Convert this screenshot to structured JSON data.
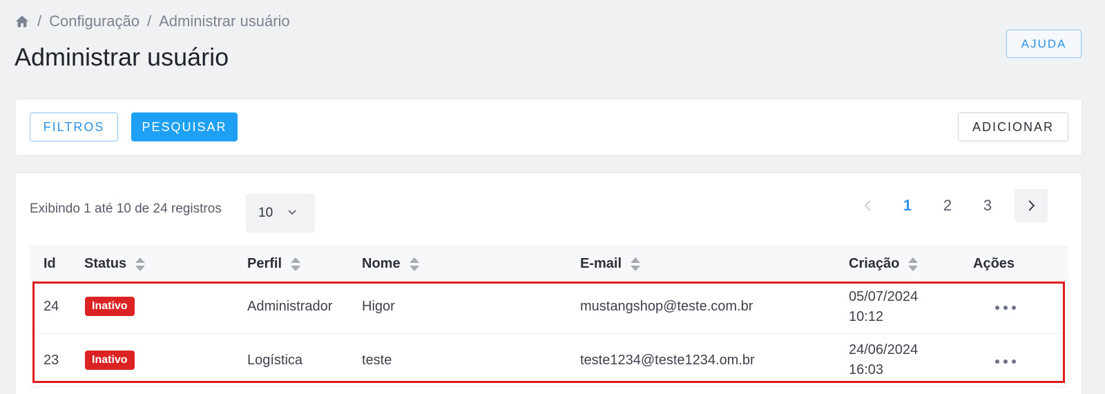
{
  "breadcrumb": {
    "home_icon": "home-icon",
    "separator": "/",
    "items": [
      "Configuração",
      "Administrar usuário"
    ]
  },
  "page_title": "Administrar usuário",
  "help_button": "AJUDA",
  "toolbar": {
    "filters": "FILTROS",
    "search": "PESQUISAR",
    "add": "ADICIONAR"
  },
  "records_info": "Exibindo 1 até 10 de 24 registros",
  "page_size": {
    "value": "10"
  },
  "pagination": {
    "pages": [
      "1",
      "2",
      "3"
    ],
    "current": "1"
  },
  "table": {
    "columns": [
      "Id",
      "Status",
      "Perfil",
      "Nome",
      "E-mail",
      "Criação",
      "Ações"
    ],
    "rows": [
      {
        "id": "24",
        "status": "Inativo",
        "perfil": "Administrador",
        "nome": "Higor",
        "email": "mustangshop@teste.com.br",
        "criacao_date": "05/07/2024",
        "criacao_time": "10:12"
      },
      {
        "id": "23",
        "status": "Inativo",
        "perfil": "Logística",
        "nome": "teste",
        "email": "teste1234@teste1234.om.br",
        "criacao_date": "24/06/2024",
        "criacao_time": "16:03"
      }
    ]
  },
  "colors": {
    "accent": "#1ea0f5",
    "inactive_badge": "#dc2323",
    "highlight": "#e01b1b"
  }
}
